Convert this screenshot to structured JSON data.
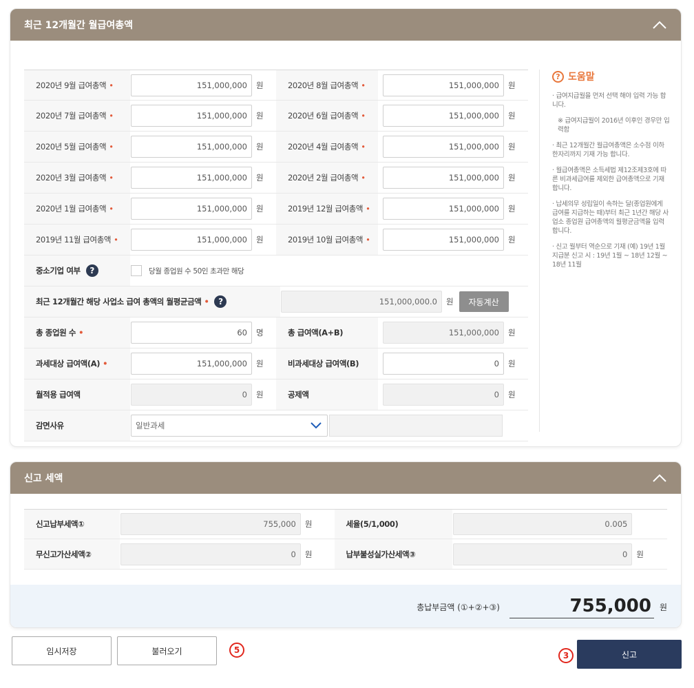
{
  "section1": {
    "title": "최근 12개월간 월급여총액",
    "rows": [
      {
        "l1": "2020년 9월 급여총액",
        "v1": "151,000,000",
        "l2": "2020년 8월 급여총액",
        "v2": "151,000,000"
      },
      {
        "l1": "2020년 7월 급여총액",
        "v1": "151,000,000",
        "l2": "2020년 6월 급여총액",
        "v2": "151,000,000"
      },
      {
        "l1": "2020년 5월 급여총액",
        "v1": "151,000,000",
        "l2": "2020년 4월 급여총액",
        "v2": "151,000,000"
      },
      {
        "l1": "2020년 3월 급여총액",
        "v1": "151,000,000",
        "l2": "2020년 2월 급여총액",
        "v2": "151,000,000"
      },
      {
        "l1": "2020년 1월 급여총액",
        "v1": "151,000,000",
        "l2": "2019년 12월 급여총액",
        "v2": "151,000,000"
      },
      {
        "l1": "2019년 11월 급여총액",
        "v1": "151,000,000",
        "l2": "2019년 10월 급여총액",
        "v2": "151,000,000"
      }
    ],
    "unit_won": "원",
    "unit_person": "명",
    "req_mark": "•",
    "sme_label": "중소기업 여부",
    "sme_checkbox_label": "당월 종업원 수 50인 초과만 해당",
    "avg_label": "최근 12개월간 해당 사업소 급여 총액의 월평균금액",
    "avg_value": "151,000,000.0",
    "calc_button": "자동계산",
    "employees_label": "총 종업원 수",
    "employees_value": "60",
    "total_pay_label": "총 급여액(A+B)",
    "total_pay_value": "151,000,000",
    "taxable_label": "과세대상 급여액(A)",
    "taxable_value": "151,000,000",
    "nontaxable_label": "비과세대상 급여액(B)",
    "nontaxable_value": "0",
    "monthly_label": "월적용 급여액",
    "monthly_value": "0",
    "deduction_label": "공제액",
    "deduction_value": "0",
    "reduction_label": "감면사유",
    "reduction_selected": "일반과세",
    "qmark": "?"
  },
  "help": {
    "title": "도움말",
    "icon": "?",
    "items": [
      "· 급여지급월을 먼저 선택 해야 입력 가능 합니다.",
      "※ 급여지급월이 2016년 이후인 경우만 입력함",
      "· 최근 12개월간 월급여총액은 소수점 이하 한자리까지 기재 가능 합니다.",
      "· 월급여총액은 소득세법 제12조제3호에 따른 비과세급여를 제외한 급여총액으로 기재합니다.",
      "· 납세의무 성립일이 속하는 달(종업원에게 급여를 지급하는 때)부터 최근 1년간 해당 사업소 종업원 급여총액의 월평균금액을 입력합니다.",
      "· 신고 월부터 역순으로 기재 (예) 19년 1월 지급분 신고 시 : 19년 1월 ~ 18년 12월 ~ 18년 11월"
    ]
  },
  "section2": {
    "title": "신고 세액",
    "report_tax_label": "신고납부세액①",
    "report_tax_value": "755,000",
    "rate_label": "세율(5/1,000)",
    "rate_value": "0.005",
    "no_report_label": "무신고가산세액②",
    "no_report_value": "0",
    "unpaid_label": "납부불성실가산세액③",
    "unpaid_value": "0",
    "total_label": "총납부금액 (①+②+③)",
    "total_value": "755,000",
    "unit_won": "원"
  },
  "buttons": {
    "temp_save": "임시저장",
    "load": "불러오기",
    "submit": "신고",
    "marker_load": "5",
    "marker_submit": "3"
  }
}
